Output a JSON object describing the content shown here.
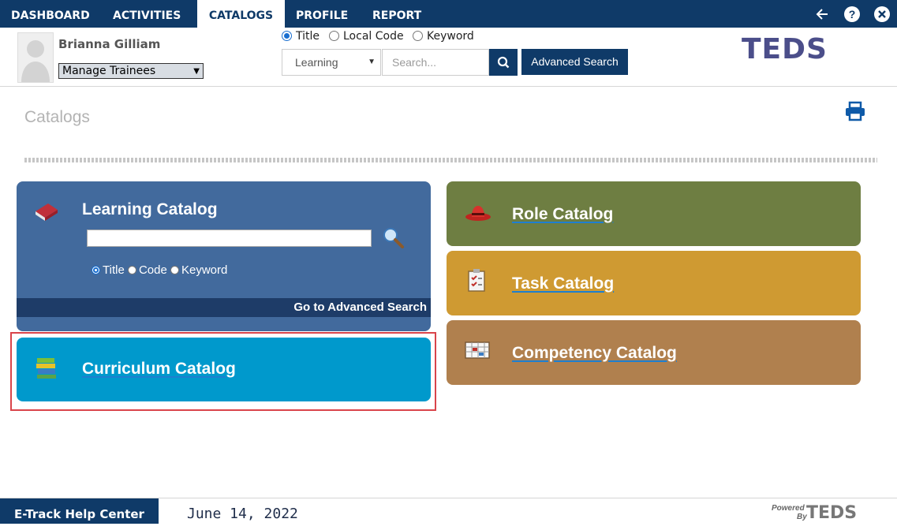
{
  "nav": {
    "items": [
      "DASHBOARD",
      "ACTIVITIES",
      "CATALOGS",
      "PROFILE",
      "REPORT"
    ],
    "active": "CATALOGS",
    "icons": [
      "arrow-left-icon",
      "help-icon",
      "close-icon"
    ]
  },
  "header": {
    "user_name": "Brianna Gilliam",
    "manage_select": "Manage Trainees",
    "search_modes": [
      "Title",
      "Local Code",
      "Keyword"
    ],
    "search_mode_selected": "Title",
    "type_select": "Learning",
    "search_placeholder": "Search...",
    "advanced_search_label": "Advanced Search",
    "logo_text": "TEDS"
  },
  "page": {
    "title": "Catalogs"
  },
  "cards": {
    "learning": {
      "title": "Learning Catalog",
      "radios": [
        "Title",
        "Code",
        "Keyword"
      ],
      "radio_selected": "Title",
      "advanced_link": "Go to Advanced Search"
    },
    "curriculum": {
      "title": "Curriculum Catalog"
    },
    "role": {
      "title": "Role Catalog"
    },
    "task": {
      "title": "Task Catalog"
    },
    "competency": {
      "title": "Competency Catalog"
    }
  },
  "colors": {
    "navy": "#0f3a68",
    "learning": "#426a9d",
    "curriculum": "#0099cc",
    "role": "#6e7e42",
    "task": "#cf9a32",
    "competency": "#b0804e",
    "highlight": "#d9444a"
  },
  "footer": {
    "help_center": "E-Track Help Center",
    "date": "June 14, 2022",
    "powered_by_line1": "Powered",
    "powered_by_line2": "By",
    "powered_logo": "TEDS"
  }
}
